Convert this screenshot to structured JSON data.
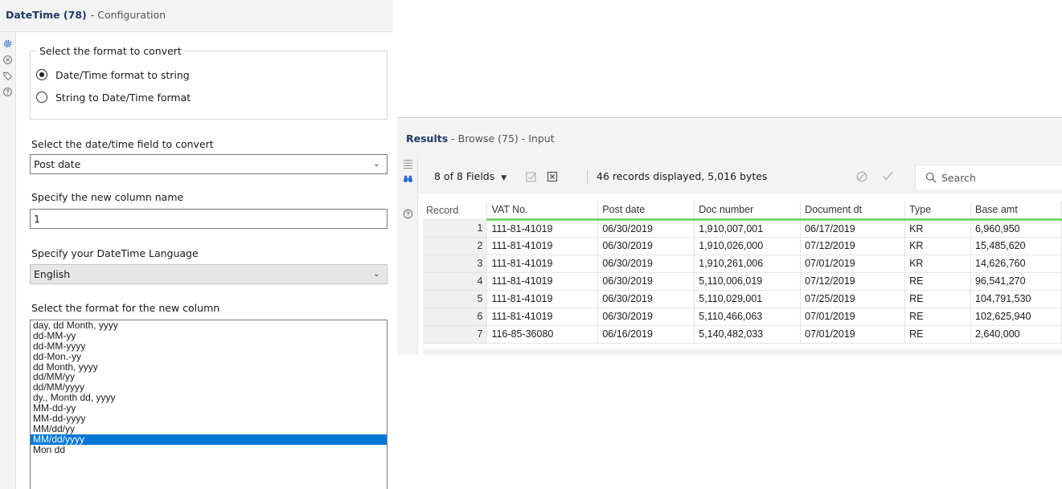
{
  "config": {
    "tool_name": "DateTime (78)",
    "tool_subtitle": "- Configuration",
    "sidebar_icons": [
      "gear-icon",
      "tag-x-icon",
      "tag-icon",
      "help-icon"
    ],
    "convert_group": {
      "legend": "Select the format to convert",
      "options": [
        "Date/Time format to string",
        "String to Date/Time format"
      ],
      "selected_index": 0
    },
    "field_label": "Select the date/time field to convert",
    "field_value": "Post date",
    "column_label": "Specify the new column name",
    "column_value": "1",
    "language_label": "Specify your DateTime Language",
    "language_value": "English",
    "format_label": "Select the format for the new column",
    "formats": [
      "day, dd Month, yyyy",
      "dd-MM-yy",
      "dd-MM-yyyy",
      "dd-Mon.-yy",
      "dd Month, yyyy",
      "dd/MM/yy",
      "dd/MM/yyyy",
      "dy., Month dd, yyyy",
      "MM-dd-yy",
      "MM-dd-yyyy",
      "MM/dd/yy",
      "MM/dd/yyyy",
      "Mon dd"
    ],
    "selected_format_index": 11
  },
  "results": {
    "title": "Results",
    "subtitle": "- Browse (75) - Input",
    "fields_label": "8 of 8 Fields",
    "records_info": "46 records displayed, 5,016 bytes",
    "search_placeholder": "Search",
    "columns": [
      "Record",
      "VAT No.",
      "Post date",
      "Doc number",
      "Document dt",
      "Type",
      "Base amt"
    ],
    "rows": [
      [
        "1",
        "111-81-41019",
        "06/30/2019",
        "1,910,007,001",
        "06/17/2019",
        "KR",
        "6,960,950"
      ],
      [
        "2",
        "111-81-41019",
        "06/30/2019",
        "1,910,026,000",
        "07/12/2019",
        "KR",
        "15,485,620"
      ],
      [
        "3",
        "111-81-41019",
        "06/30/2019",
        "1,910,261,006",
        "07/01/2019",
        "KR",
        "14,626,760"
      ],
      [
        "4",
        "111-81-41019",
        "06/30/2019",
        "5,110,006,019",
        "07/12/2019",
        "RE",
        "96,541,270"
      ],
      [
        "5",
        "111-81-41019",
        "06/30/2019",
        "5,110,029,001",
        "07/25/2019",
        "RE",
        "104,791,530"
      ],
      [
        "6",
        "111-81-41019",
        "06/30/2019",
        "5,110,466,063",
        "07/01/2019",
        "RE",
        "102,625,940"
      ],
      [
        "7",
        "116-85-36080",
        "06/16/2019",
        "5,140,482,033",
        "07/01/2019",
        "RE",
        "2,640,000"
      ]
    ]
  },
  "colors": {
    "accent_blue": "#0078d7",
    "header_green": "#7fd36b",
    "title_navy": "#1f3a66"
  }
}
